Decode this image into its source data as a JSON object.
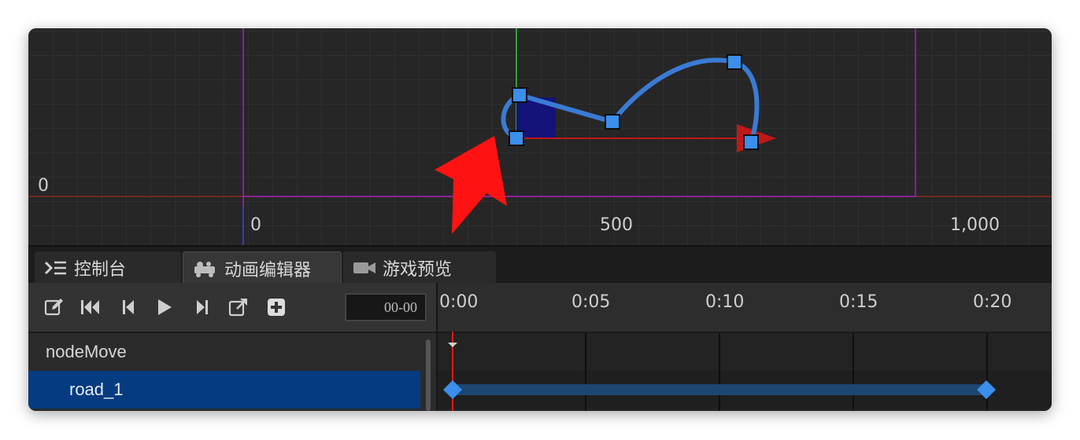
{
  "scene": {
    "axis_labels": {
      "y_zero": "0",
      "x_zero": "0",
      "x_500": "500",
      "x_1000": "1,000"
    }
  },
  "tabs": [
    {
      "label": "控制台",
      "icon": "terminal-icon"
    },
    {
      "label": "动画编辑器",
      "icon": "animation-editor-icon"
    },
    {
      "label": "游戏预览",
      "icon": "video-camera-icon"
    }
  ],
  "toolbar": {
    "buttons": [
      "edit-icon",
      "jump-to-start-icon",
      "previous-frame-icon",
      "play-icon",
      "next-frame-icon",
      "external-link-icon",
      "add-icon"
    ],
    "time_value": "00-00"
  },
  "nodes": {
    "root": "nodeMove",
    "child": "road_1"
  },
  "timeline": {
    "ticks": [
      "0:00",
      "0:05",
      "0:10",
      "0:15",
      "0:20"
    ]
  },
  "colors": {
    "path": "#3a7bd5",
    "selection": "#053b80",
    "keyframe": "#3b8eea",
    "playhead": "#e01a1a",
    "boundary": "#a020c0"
  }
}
